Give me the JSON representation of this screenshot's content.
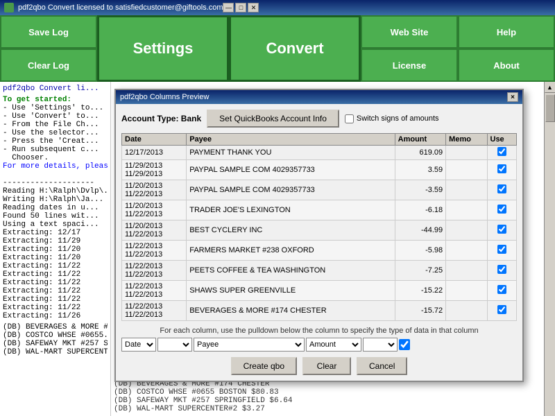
{
  "titlebar": {
    "title": "pdf2qbo Convert licensed to satisfiedcustomer@giftools.com",
    "min_btn": "—",
    "max_btn": "□",
    "close_btn": "✕"
  },
  "toolbar": {
    "save_log": "Save Log",
    "clear_log": "Clear Log",
    "settings": "Settings",
    "convert": "Convert",
    "web_site": "Web Site",
    "help": "Help",
    "license": "License",
    "about": "About"
  },
  "log": {
    "title": "pdf2qbo Convert li...",
    "section1_label": "To get started:",
    "lines": [
      "- Use 'Settings' to...",
      "- Use 'Convert' to...",
      "- From the File Ch...",
      "- Use the selector...",
      "- Press the 'Creat...",
      "- Run subsequent c...",
      "  Chooser.",
      "",
      "For more details, pleas...",
      "",
      "--------------------",
      "Reading H:\\Ralph\\Dvlp\\...",
      "Writing H:\\Ralph\\Ja...",
      "Reading dates in u...",
      "Found 50 lines wit...",
      "Using a text spaci...",
      "Extracting: 12/17",
      "Extracting: 11/29",
      "Extracting: 11/20",
      "Extracting: 11/20",
      "Extracting: 11/22",
      "Extracting: 11/22",
      "Extracting: 11/22",
      "Extracting: 11/22",
      "Extracting: 11/22",
      "Extracting: 11/22",
      "Extracting: 11/26"
    ],
    "bottom_lines": [
      "(DB) BEVERAGES & MORE #174 CHESTER",
      "(DB) COSTCO WHSE #0655 BOSTON $80.83",
      "(DB) SAFEWAY MKT #257 SPRINGFIELD $6.64",
      "(DB) WAL-MART SUPERCENTER#2 $3.27"
    ]
  },
  "modal": {
    "title": "pdf2qbo Columns Preview",
    "close": "×",
    "account_type_label": "Account Type:",
    "account_type_value": "Bank",
    "set_quickbooks_btn": "Set QuickBooks Account Info",
    "switch_signs_label": "Switch signs of amounts",
    "table": {
      "headers": [
        "Date",
        "Payee",
        "Amount",
        "Memo",
        "Use"
      ],
      "rows": [
        {
          "date": "12/17/2013",
          "date2": "",
          "payee": "PAYMENT THANK YOU",
          "amount": "619.09",
          "memo": "",
          "use": true
        },
        {
          "date": "11/29/2013",
          "date2": "11/29/2013",
          "payee": "PAYPAL SAMPLE COM  4029357733",
          "amount": "3.59",
          "memo": "",
          "use": true
        },
        {
          "date": "11/20/2013",
          "date2": "11/22/2013",
          "payee": "PAYPAL SAMPLE COM  4029357733",
          "amount": "-3.59",
          "memo": "",
          "use": true
        },
        {
          "date": "11/20/2013",
          "date2": "11/22/2013",
          "payee": "TRADER JOE'S LEXINGTON",
          "amount": "-6.18",
          "memo": "",
          "use": true
        },
        {
          "date": "11/20/2013",
          "date2": "11/22/2013",
          "payee": "BEST CYCLERY INC",
          "amount": "-44.99",
          "memo": "",
          "use": true
        },
        {
          "date": "11/22/2013",
          "date2": "11/22/2013",
          "payee": "FARMERS MARKET #238 OXFORD",
          "amount": "-5.98",
          "memo": "",
          "use": true
        },
        {
          "date": "11/22/2013",
          "date2": "11/22/2013",
          "payee": "PEETS COFFEE & TEA WASHINGTON",
          "amount": "-7.25",
          "memo": "",
          "use": true
        },
        {
          "date": "11/22/2013",
          "date2": "11/22/2013",
          "payee": "SHAWS SUPER GREENVILLE",
          "amount": "-15.22",
          "memo": "",
          "use": true
        },
        {
          "date": "11/22/2013",
          "date2": "11/22/2013",
          "payee": "BEVERAGES & MORE #174 CHESTER",
          "amount": "-15.72",
          "memo": "",
          "use": true
        }
      ]
    },
    "col_hint": "For each column, use the pulldown below the column to specify the type of data in that column",
    "col_selectors": {
      "date_label": "Date",
      "empty_label": "",
      "payee_label": "Payee",
      "amount_label": "Amount"
    },
    "buttons": {
      "create": "Create qbo",
      "clear": "Clear",
      "cancel": "Cancel"
    }
  }
}
